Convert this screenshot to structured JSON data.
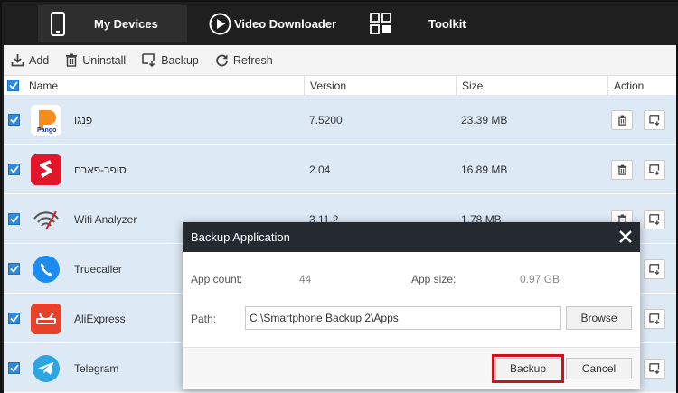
{
  "nav": {
    "tabs": [
      {
        "label": "My Devices",
        "icon": "phone-icon",
        "active": true
      },
      {
        "label": "Video Downloader",
        "icon": "play-circle-icon",
        "active": false
      },
      {
        "label": "Toolkit",
        "icon": "grid-icon",
        "active": false
      }
    ]
  },
  "toolbar": {
    "add_label": "Add",
    "uninstall_label": "Uninstall",
    "backup_label": "Backup",
    "refresh_label": "Refresh"
  },
  "table": {
    "columns": [
      "Name",
      "Version",
      "Size",
      "Action"
    ],
    "rows": [
      {
        "name": "פנגו",
        "version": "7.5200",
        "size": "23.39 MB",
        "icon": "pango-app-icon"
      },
      {
        "name": "סופר-פארם",
        "version": "2.04",
        "size": "16.89 MB",
        "icon": "super-pharm-app-icon"
      },
      {
        "name": "Wifi Analyzer",
        "version": "3.11.2",
        "size": "1.78 MB",
        "icon": "wifi-analyzer-app-icon"
      },
      {
        "name": "Truecaller",
        "version": "",
        "size": "",
        "icon": "truecaller-app-icon"
      },
      {
        "name": "AliExpress",
        "version": "",
        "size": "",
        "icon": "aliexpress-app-icon"
      },
      {
        "name": "Telegram",
        "version": "",
        "size": "",
        "icon": "telegram-app-icon"
      }
    ]
  },
  "modal": {
    "title": "Backup Application",
    "app_count_label": "App count:",
    "app_count_value": "44",
    "app_size_label": "App size:",
    "app_size_value": "0.97 GB",
    "path_label": "Path:",
    "path_value": "C:\\Smartphone Backup 2\\Apps",
    "browse_label": "Browse",
    "backup_label": "Backup",
    "cancel_label": "Cancel"
  },
  "colors": {
    "nav_bg": "#1f1f1f",
    "row_bg": "#dde9f5",
    "checkbox": "#2d8ae0",
    "modal_header": "#252a31",
    "highlight": "#d0101a"
  }
}
